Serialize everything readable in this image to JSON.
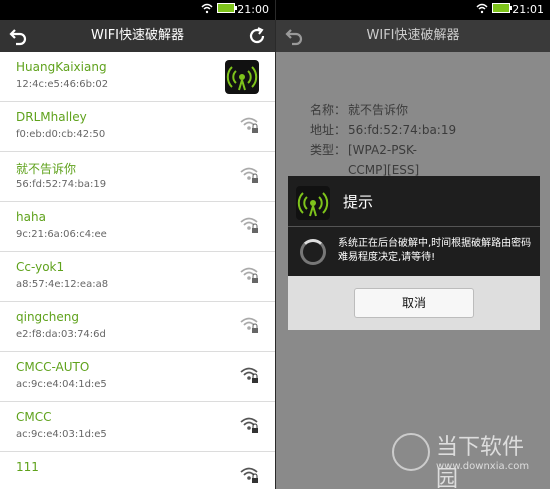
{
  "left": {
    "status": {
      "time": "21:00"
    },
    "title": "WIFI快速破解器",
    "networks": [
      {
        "ssid": "HuangKaixiang",
        "mac": "12:4c:e5:46:6b:02",
        "icon": "app-wifi-icon"
      },
      {
        "ssid": "DRLMhalley",
        "mac": "f0:eb:d0:cb:42:50",
        "icon": "wifi-lock-icon"
      },
      {
        "ssid": "就不告诉你",
        "mac": "56:fd:52:74:ba:19",
        "icon": "wifi-lock-icon"
      },
      {
        "ssid": "haha",
        "mac": "9c:21:6a:06:c4:ee",
        "icon": "wifi-lock-icon"
      },
      {
        "ssid": "Cc-yok1",
        "mac": "a8:57:4e:12:ea:a8",
        "icon": "wifi-lock-icon"
      },
      {
        "ssid": "qingcheng",
        "mac": "e2:f8:da:03:74:6d",
        "icon": "wifi-lock-icon"
      },
      {
        "ssid": "CMCC-AUTO",
        "mac": "ac:9c:e4:04:1d:e5",
        "icon": "wifi-lock-icon"
      },
      {
        "ssid": "CMCC",
        "mac": "ac:9c:e4:03:1d:e5",
        "icon": "wifi-lock-icon"
      },
      {
        "ssid": "111",
        "mac": "",
        "icon": "wifi-lock-icon"
      }
    ]
  },
  "right": {
    "status": {
      "time": "21:01"
    },
    "title": "WIFI快速破解器",
    "info": {
      "name_label": "名称：",
      "name_value": "就不告诉你",
      "addr_label": "地址：",
      "addr_value": "56:fd:52:74:ba:19",
      "type_label": "类型：",
      "type_value_line1": "[WPA2-PSK-",
      "type_value_line2": "CCMP][ESS]"
    },
    "dialog": {
      "title": "提示",
      "message": "系统正在后台破解中,时间根据破解路由密码难易程度决定,请等待!",
      "cancel_label": "取消"
    },
    "watermark": {
      "line1": "当下软件园",
      "line2": "www.downxia.com"
    }
  },
  "colors": {
    "ssid_green": "#5fa21c",
    "statusbar": "#000000",
    "titlebar": "#333333"
  }
}
